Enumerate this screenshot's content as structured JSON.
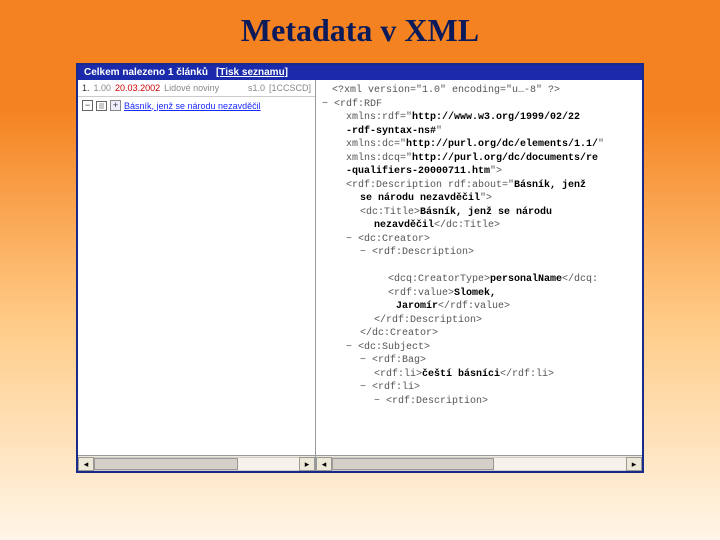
{
  "title": "Metadata v XML",
  "header": {
    "found": "Celkem nalezeno 1 článků",
    "print": "[Tisk seznamu]"
  },
  "left": {
    "row1": {
      "num": "1.",
      "pct": "1.00",
      "date": "20.03.2002",
      "source": "Lidové noviny",
      "page": "s1.0",
      "code": "[1CCSCD]"
    },
    "row2": {
      "expand": "−",
      "plus": "+",
      "link": "Básník, jenž se národu nezavděčil"
    }
  },
  "xml": {
    "l0": "<?xml version=\"1.0\" encoding=\"u…-8\" ?>",
    "l1_pre": "− <rdf:RDF",
    "l2a": "xmlns:rdf=\"",
    "l2b": "http://www.w3.org/1999/02/22",
    "l2c": "-rdf-syntax-ns#",
    "l2d": "\"",
    "l3a": "xmlns:dc=\"",
    "l3b": "http://purl.org/dc/elements/1.1/",
    "l3c": "\"",
    "l4a": "xmlns:dcq=\"",
    "l4b": "http://purl.org/dc/documents/re",
    "l4c": "-qualifiers-20000711.htm",
    "l4d": "\">",
    "l5a": "<rdf:Description rdf:about=\"",
    "l5b": "Básník, jenž",
    "l6": "se národu nezavděčil",
    "l6b": "\">",
    "l7a": "<dc:Title>",
    "l7b": "Básník, jenž se národu",
    "l8a": "nezavděčil",
    "l8b": "</dc:Title>",
    "l9": "− <dc:Creator>",
    "l10": "− <rdf:Description>",
    "l11a": "<dcq:CreatorType>",
    "l11b": "personalName",
    "l11c": "</dcq:",
    "l12a": "<rdf:value>",
    "l12b": "Slomek,",
    "l13a": "Jaromír",
    "l13b": "</rdf:value>",
    "l14": "</rdf:Description>",
    "l15": "</dc:Creator>",
    "l16": "− <dc:Subject>",
    "l17": "− <rdf:Bag>",
    "l18a": "<rdf:li>",
    "l18b": "čeští básníci",
    "l18c": "</rdf:li>",
    "l19": "− <rdf:li>",
    "l20": "− <rdf:Description>"
  }
}
